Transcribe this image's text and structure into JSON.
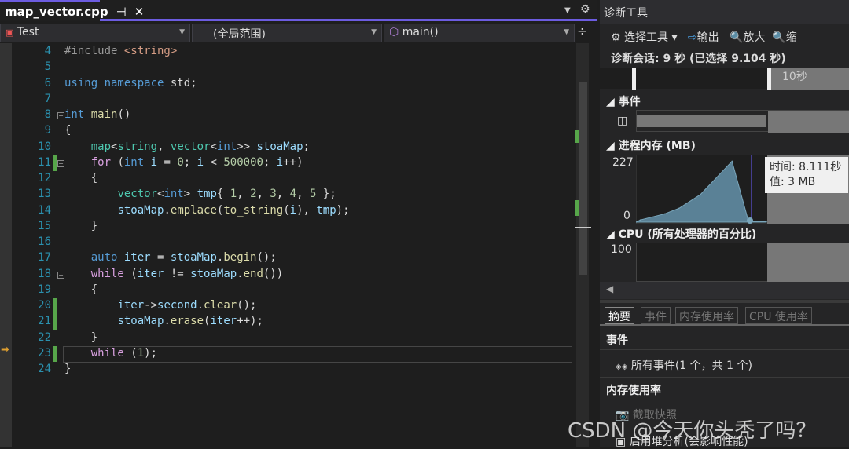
{
  "editor": {
    "tab_title": "map_vector.cpp",
    "pin": "⊣",
    "close": "✕",
    "project": "Test",
    "scope": "(全局范围)",
    "member": "main()",
    "split": "÷"
  },
  "code": [
    {
      "n": "4",
      "t": [
        [
          "pp",
          "#include "
        ],
        [
          "st",
          "<string>"
        ]
      ]
    },
    {
      "n": "5",
      "t": []
    },
    {
      "n": "6",
      "t": [
        [
          "kw",
          "using namespace "
        ],
        [
          "",
          "std;"
        ]
      ]
    },
    {
      "n": "7",
      "t": []
    },
    {
      "n": "8",
      "t": [
        [
          "kw",
          "int "
        ],
        [
          "fn",
          "main"
        ],
        [
          "",
          "()"
        ]
      ],
      "fold": true
    },
    {
      "n": "9",
      "t": [
        [
          "",
          "{"
        ]
      ]
    },
    {
      "n": "10",
      "t": [
        [
          "",
          "    "
        ],
        [
          "ty",
          "map"
        ],
        [
          "",
          "<"
        ],
        [
          "ty",
          "string"
        ],
        [
          "",
          ", "
        ],
        [
          "ty",
          "vector"
        ],
        [
          "",
          "<"
        ],
        [
          "kw",
          "int"
        ],
        [
          "",
          ">> "
        ],
        [
          "va",
          "stoaMap"
        ],
        [
          "",
          ";"
        ]
      ]
    },
    {
      "n": "11",
      "t": [
        [
          "",
          "    "
        ],
        [
          "ct",
          "for "
        ],
        [
          "",
          "("
        ],
        [
          "kw",
          "int "
        ],
        [
          "va",
          "i"
        ],
        [
          "",
          " = "
        ],
        [
          "nm",
          "0"
        ],
        [
          "",
          "; "
        ],
        [
          "va",
          "i"
        ],
        [
          "",
          " < "
        ],
        [
          "nm",
          "500000"
        ],
        [
          "",
          "; "
        ],
        [
          "va",
          "i"
        ],
        [
          "",
          "++)"
        ]
      ],
      "fold": true,
      "chg": true
    },
    {
      "n": "12",
      "t": [
        [
          "",
          "    {"
        ]
      ]
    },
    {
      "n": "13",
      "t": [
        [
          "",
          "        "
        ],
        [
          "ty",
          "vector"
        ],
        [
          "",
          "<"
        ],
        [
          "kw",
          "int"
        ],
        [
          "",
          "> "
        ],
        [
          "va",
          "tmp"
        ],
        [
          "",
          "{ "
        ],
        [
          "nm",
          "1"
        ],
        [
          "",
          ", "
        ],
        [
          "nm",
          "2"
        ],
        [
          "",
          ", "
        ],
        [
          "nm",
          "3"
        ],
        [
          "",
          ", "
        ],
        [
          "nm",
          "4"
        ],
        [
          "",
          ", "
        ],
        [
          "nm",
          "5"
        ],
        [
          "",
          " };"
        ]
      ]
    },
    {
      "n": "14",
      "t": [
        [
          "",
          "        "
        ],
        [
          "va",
          "stoaMap"
        ],
        [
          "",
          "."
        ],
        [
          "fn",
          "emplace"
        ],
        [
          "",
          "("
        ],
        [
          "fn",
          "to_string"
        ],
        [
          "",
          "("
        ],
        [
          "va",
          "i"
        ],
        [
          "",
          "), "
        ],
        [
          "va",
          "tmp"
        ],
        [
          "",
          ");"
        ]
      ]
    },
    {
      "n": "15",
      "t": [
        [
          "",
          "    }"
        ]
      ]
    },
    {
      "n": "16",
      "t": []
    },
    {
      "n": "17",
      "t": [
        [
          "",
          "    "
        ],
        [
          "kw",
          "auto "
        ],
        [
          "va",
          "iter"
        ],
        [
          "",
          " = "
        ],
        [
          "va",
          "stoaMap"
        ],
        [
          "",
          "."
        ],
        [
          "fn",
          "begin"
        ],
        [
          "",
          "();"
        ]
      ]
    },
    {
      "n": "18",
      "t": [
        [
          "",
          "    "
        ],
        [
          "ct",
          "while "
        ],
        [
          "",
          "("
        ],
        [
          "va",
          "iter"
        ],
        [
          "",
          " != "
        ],
        [
          "va",
          "stoaMap"
        ],
        [
          "",
          "."
        ],
        [
          "fn",
          "end"
        ],
        [
          "",
          "())"
        ]
      ],
      "fold": true
    },
    {
      "n": "19",
      "t": [
        [
          "",
          "    {"
        ]
      ]
    },
    {
      "n": "20",
      "t": [
        [
          "",
          "        "
        ],
        [
          "va",
          "iter"
        ],
        [
          "",
          "->"
        ],
        [
          "va",
          "second"
        ],
        [
          "",
          "."
        ],
        [
          "fn",
          "clear"
        ],
        [
          "",
          "();"
        ]
      ],
      "chg": true
    },
    {
      "n": "21",
      "t": [
        [
          "",
          "        "
        ],
        [
          "va",
          "stoaMap"
        ],
        [
          "",
          "."
        ],
        [
          "fn",
          "erase"
        ],
        [
          "",
          "("
        ],
        [
          "va",
          "iter"
        ],
        [
          "",
          "++);"
        ]
      ],
      "chg": true
    },
    {
      "n": "22",
      "t": [
        [
          "",
          "    }"
        ]
      ]
    },
    {
      "n": "23",
      "t": [
        [
          "",
          "    "
        ],
        [
          "ct",
          "while "
        ],
        [
          "",
          "("
        ],
        [
          "nm",
          "1"
        ],
        [
          "",
          ");"
        ]
      ],
      "chg": true,
      "current": true
    },
    {
      "n": "24",
      "t": [
        [
          "",
          "}"
        ]
      ]
    }
  ],
  "diag": {
    "title": "诊断工具",
    "select_tools": "选择工具",
    "output": "输出",
    "zoom_in": "放大",
    "zoom_out": "缩",
    "session": "诊断会话: 9 秒 (已选择 9.104 秒)",
    "timeline_label": "10秒",
    "events_section": "事件",
    "memory_section": "进程内存 (MB)",
    "mem_max": "227",
    "mem_min": "0",
    "tooltip_time": "时间: 8.111秒",
    "tooltip_value": "值: 3 MB",
    "cpu_section": "CPU (所有处理器的百分比)",
    "cpu_max": "100",
    "tabs": [
      "摘要",
      "事件",
      "内存使用率",
      "CPU 使用率"
    ],
    "summary_events": "事件",
    "all_events": "所有事件(1 个，共 1 个)",
    "memory_usage": "内存使用率",
    "snapshot": "截取快照",
    "heap": "启用堆分析(会影响性能)"
  },
  "chart_data": {
    "type": "area",
    "x": [
      0,
      0.3,
      2,
      3,
      4.5,
      6.7,
      7.85,
      9.1
    ],
    "values": [
      0,
      8,
      30,
      50,
      100,
      220,
      3,
      3
    ],
    "ylim": [
      0,
      227
    ],
    "xlim": [
      0,
      9.1
    ],
    "color": "#5a8196"
  },
  "watermark": "CSDN @今天你头秃了吗？"
}
